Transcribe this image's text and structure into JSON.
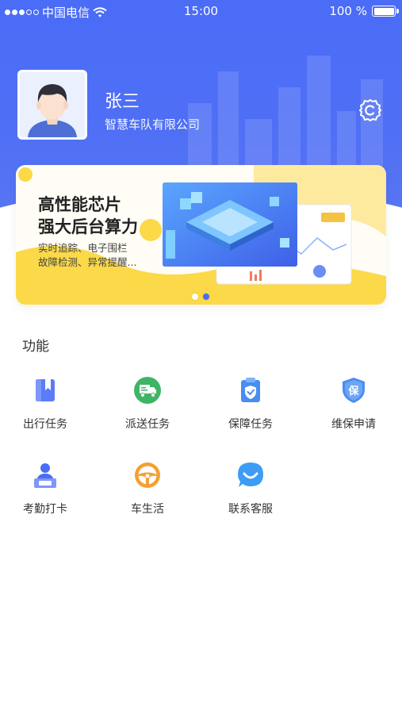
{
  "status_bar": {
    "carrier": "中国电信",
    "time": "15:00",
    "battery": "100 %"
  },
  "profile": {
    "name": "张三",
    "company": "智慧车队有限公司"
  },
  "banner": {
    "title_line1": "高性能芯片",
    "title_line2": "强大后台算力",
    "sub_line1": "实时追踪、电子围栏",
    "sub_line2": "故障检测、异常提醒...",
    "page_count": 2,
    "active_page": 2
  },
  "section": {
    "title": "功能"
  },
  "functions": [
    {
      "label": "出行任务",
      "icon": "book-icon",
      "color": "#5b7cf8"
    },
    {
      "label": "派送任务",
      "icon": "truck-icon",
      "color": "#3fb466"
    },
    {
      "label": "保障任务",
      "icon": "clipboard-check-icon",
      "color": "#4a8df0"
    },
    {
      "label": "维保申请",
      "icon": "shield-bao-icon",
      "color": "#4a8df0"
    },
    {
      "label": "考勤打卡",
      "icon": "attendance-icon",
      "color": "#4a6cf7"
    },
    {
      "label": "车生活",
      "icon": "steering-wheel-icon",
      "color": "#f5a033"
    },
    {
      "label": "联系客服",
      "icon": "chat-smile-icon",
      "color": "#3d9cf5"
    }
  ]
}
